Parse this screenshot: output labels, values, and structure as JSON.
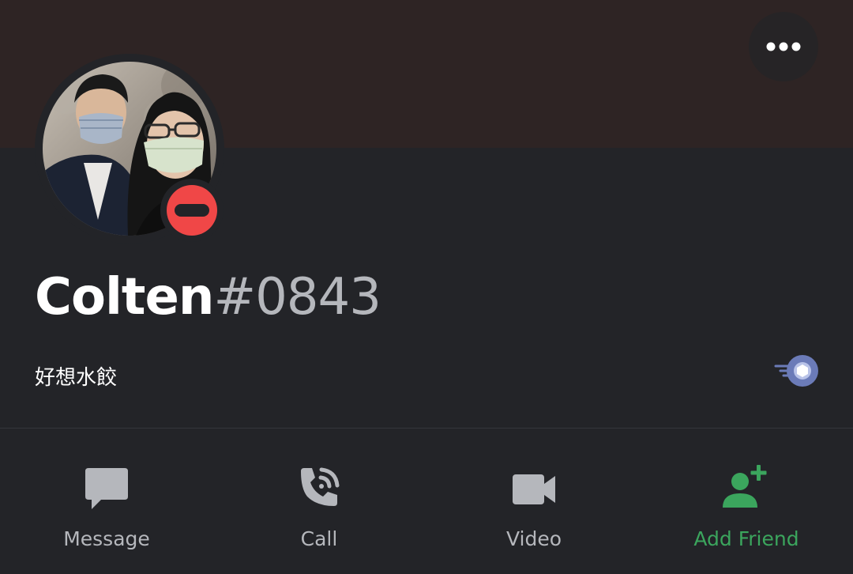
{
  "profile": {
    "username": "Colten",
    "discriminator": "#0843",
    "custom_status": "好想水餃",
    "status": "do-not-disturb",
    "avatar_icon": "avatar-photo",
    "badge_icon": "nitro-badge-icon"
  },
  "header": {
    "more_icon": "more-horizontal-icon"
  },
  "actions": [
    {
      "label": "Message",
      "icon": "message-icon"
    },
    {
      "label": "Call",
      "icon": "call-icon"
    },
    {
      "label": "Video",
      "icon": "video-icon"
    },
    {
      "label": "Add Friend",
      "icon": "add-friend-icon"
    }
  ],
  "colors": {
    "banner": "#2e2424",
    "background": "#232428",
    "dnd_red": "#f04747",
    "add_friend_green": "#3ba55d",
    "muted_text": "#b5b7bc"
  }
}
